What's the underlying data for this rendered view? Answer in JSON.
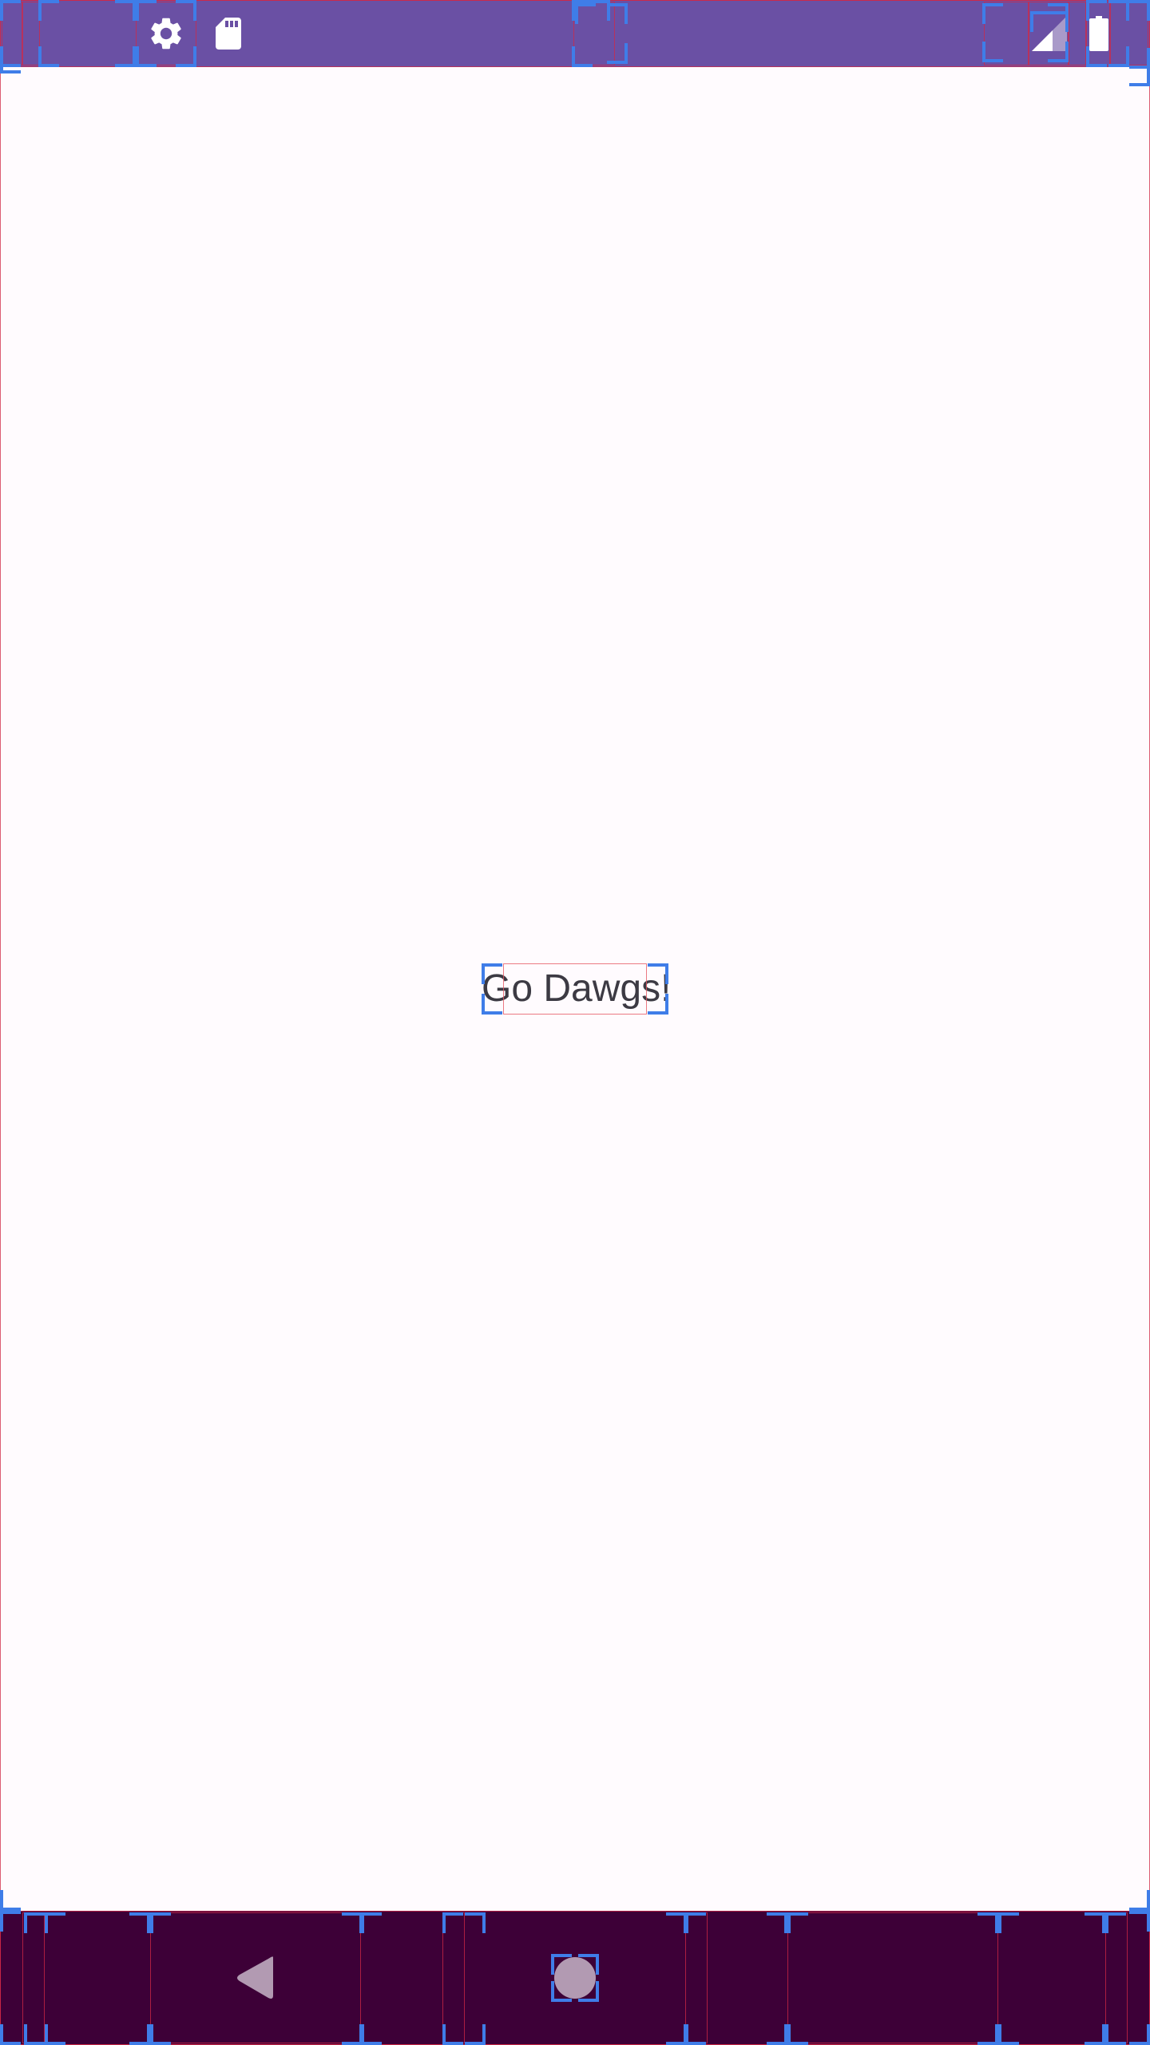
{
  "status_bar": {
    "background": "#6a50a4",
    "icons": [
      "gear-icon",
      "sd-card-icon",
      "cell-signal-icon",
      "battery-icon"
    ]
  },
  "content": {
    "greeting": "Go Dawgs!",
    "background": "#fffbfe"
  },
  "nav_bar": {
    "background": "#3d0037",
    "buttons": [
      "back-button",
      "home-button"
    ]
  }
}
